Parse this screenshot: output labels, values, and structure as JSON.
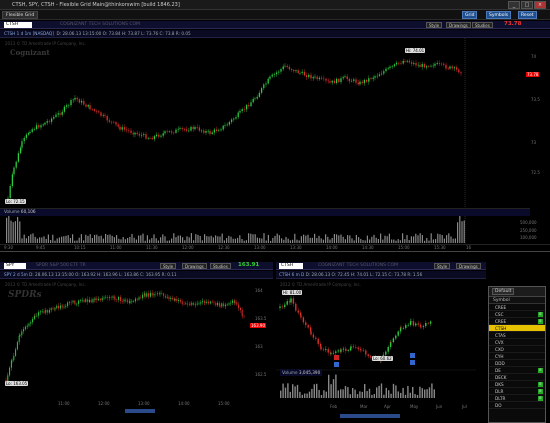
{
  "window": {
    "title": "CTSH, SPY, CTSH - Flexible Grid Main@thinkorswim [build 1846.23]",
    "tab_label": "Flexible Grid",
    "top_buttons": [
      "Grid",
      "Symbols",
      "Reset"
    ]
  },
  "main_chart": {
    "symbol": "CTSH",
    "company": "COGNIZANT TECH SOLUTIONS COM",
    "timeframe": "CTSH 1 d 1m [NASDAQ]",
    "ohlc": "D: 28.06.13 13:15:00  O: 73.84  H: 73.87  L: 73.76  C: 73.8  R: 0.05",
    "copyright": "2013 © TD Ameritrade IP Company, Inc.",
    "watermark": "Cognizant",
    "buttons": [
      "Style",
      "Drawings",
      "Studies"
    ],
    "quote": "73.78",
    "y_ticks": [
      "74",
      "73.5",
      "73",
      "72.5"
    ],
    "x_ticks": [
      "9:30",
      "9:45",
      "10:15",
      "11:00",
      "11:30",
      "12:00",
      "12:30",
      "13:00",
      "13:30",
      "14:00",
      "14:30",
      "15:00",
      "15:30",
      "16"
    ],
    "hi_label": "Hi: 74.01",
    "lo_label": "Lo: 72.15",
    "volume_label": "Volume",
    "volume_value": "60,106",
    "volume_ticks": [
      "500,000",
      "250,000",
      "100,000"
    ]
  },
  "spy_chart": {
    "symbol": "SPY",
    "company": "SPDR S&P 500 ETF TR",
    "quote": "163.91",
    "timeframe": "SPY 2 d 5m",
    "ohlc": "D: 28.06.13 13:15:00  O: 163.92  H: 163.96  L: 163.86  C: 163.95  R: 0.11",
    "copyright": "2013 © TD Ameritrade IP Company, Inc.",
    "watermark": "SPDRs",
    "buttons": [
      "Style",
      "Drawings",
      "Studies"
    ],
    "y_ticks": [
      "164",
      "163.5",
      "163",
      "162.5"
    ],
    "x_ticks": [
      "11:00",
      "12:00",
      "13:00",
      "14:00",
      "15:00"
    ],
    "quote_tag": "163.90",
    "lo_label": "Lo: 163.05"
  },
  "ctsh6m_chart": {
    "symbol": "CTSH",
    "company": "COGNIZANT TECH SOLUTIONS COM",
    "timeframe": "CTSH 6 m D",
    "ohlc": "D: 28.06.13  O: 72.45  H: 74.01  L: 72.15  C: 73.78  R: 1.56",
    "copyright": "2013 © TD Ameritrade IP Company, Inc.",
    "buttons": [
      "Style",
      "Drawings",
      "Studies"
    ],
    "hi_label": "Hi: 81.00",
    "lo_label": "Lo: 60.62",
    "volume_label": "Volume",
    "volume_value": "3,045,390",
    "x_ticks": [
      "Feb",
      "Mar",
      "Apr",
      "May",
      "Jun",
      "Jul"
    ]
  },
  "watchlist": {
    "title": "Default",
    "column": "Symbol",
    "items": [
      {
        "symbol": "CREE",
        "badge": ""
      },
      {
        "symbol": "CSC",
        "badge": "E"
      },
      {
        "symbol": "CREE",
        "badge": "E"
      },
      {
        "symbol": "CTSH",
        "badge": ""
      },
      {
        "symbol": "CTAS",
        "badge": ""
      },
      {
        "symbol": "CVX",
        "badge": ""
      },
      {
        "symbol": "CXO",
        "badge": ""
      },
      {
        "symbol": "CYH",
        "badge": ""
      },
      {
        "symbol": "DDD",
        "badge": ""
      },
      {
        "symbol": "DE",
        "badge": "E"
      },
      {
        "symbol": "DECK",
        "badge": ""
      },
      {
        "symbol": "DKS",
        "badge": "E"
      },
      {
        "symbol": "DLR",
        "badge": "E"
      },
      {
        "symbol": "DLTR",
        "badge": "E"
      },
      {
        "symbol": "DO",
        "badge": ""
      }
    ],
    "selected_index": 3
  },
  "colors": {
    "up": "#2ecc40",
    "down": "#e0302a",
    "accent": "#1f4f8f",
    "background": "#000000"
  }
}
